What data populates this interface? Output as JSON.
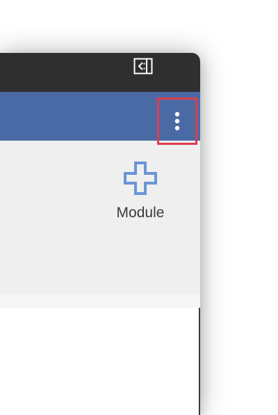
{
  "toolbar": {
    "add_module_label": "Module"
  },
  "icons": {
    "panel_toggle": "panel-collapse-icon",
    "more": "more-vertical-icon",
    "add": "plus-icon"
  },
  "colors": {
    "titlebar": "#2f2f2f",
    "appbar": "#4a6aa5",
    "toolbar_bg": "#efefef",
    "accent_plus": "#6b94d8",
    "highlight": "#e03c4a"
  }
}
